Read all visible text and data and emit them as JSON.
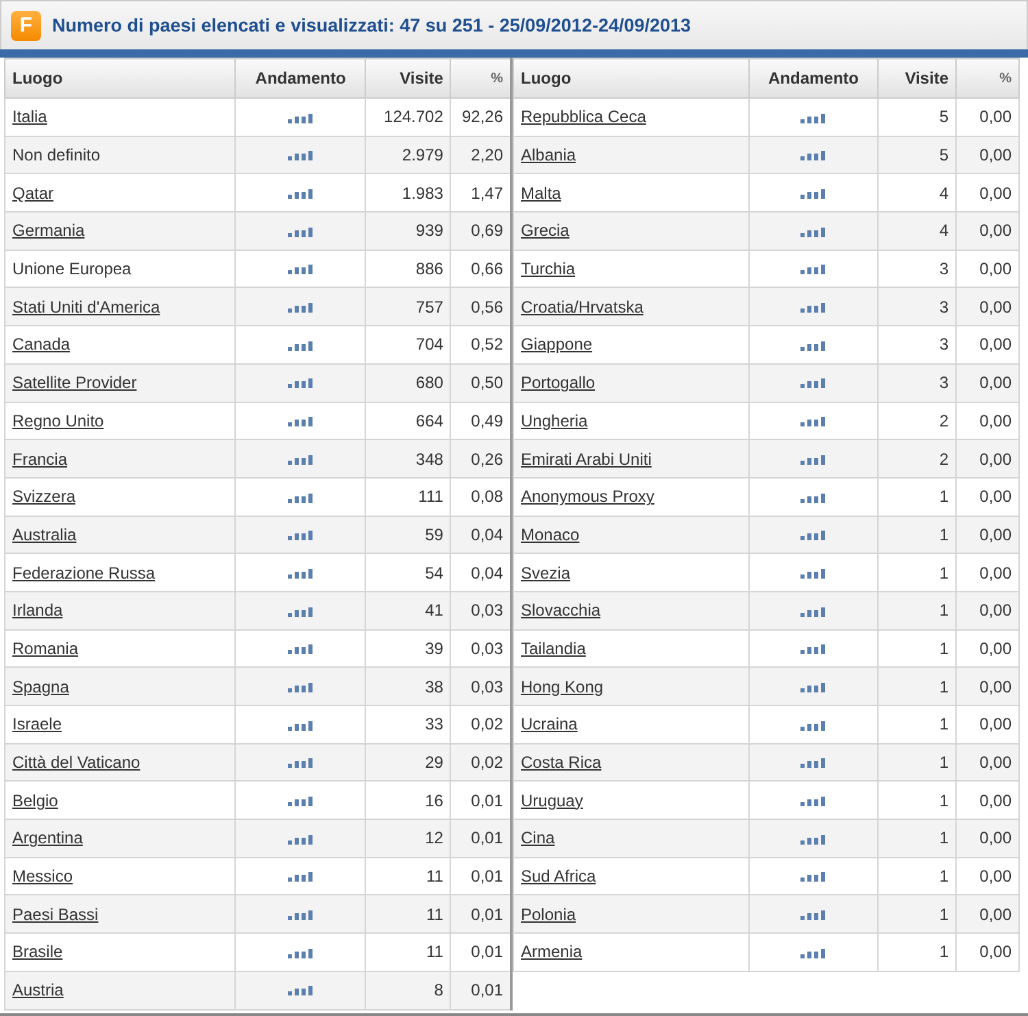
{
  "header": {
    "logo_letter": "F",
    "title": "Numero di paesi elencati e visualizzati: 47 su 251 - 25/09/2012-24/09/2013"
  },
  "tables": [
    {
      "columns": [
        "Luogo",
        "Andamento",
        "Visite",
        "%"
      ],
      "rows": [
        {
          "name": "Italia",
          "link": true,
          "visits": "124.702",
          "percent": "92,26"
        },
        {
          "name": "Non definito",
          "link": false,
          "visits": "2.979",
          "percent": "2,20"
        },
        {
          "name": "Qatar",
          "link": true,
          "visits": "1.983",
          "percent": "1,47"
        },
        {
          "name": "Germania",
          "link": true,
          "visits": "939",
          "percent": "0,69"
        },
        {
          "name": "Unione Europea",
          "link": false,
          "visits": "886",
          "percent": "0,66"
        },
        {
          "name": "Stati Uniti d'America",
          "link": true,
          "visits": "757",
          "percent": "0,56"
        },
        {
          "name": "Canada",
          "link": true,
          "visits": "704",
          "percent": "0,52"
        },
        {
          "name": "Satellite Provider",
          "link": true,
          "visits": "680",
          "percent": "0,50"
        },
        {
          "name": "Regno Unito",
          "link": true,
          "visits": "664",
          "percent": "0,49"
        },
        {
          "name": "Francia",
          "link": true,
          "visits": "348",
          "percent": "0,26"
        },
        {
          "name": "Svizzera",
          "link": true,
          "visits": "111",
          "percent": "0,08"
        },
        {
          "name": "Australia",
          "link": true,
          "visits": "59",
          "percent": "0,04"
        },
        {
          "name": "Federazione Russa",
          "link": true,
          "visits": "54",
          "percent": "0,04"
        },
        {
          "name": "Irlanda",
          "link": true,
          "visits": "41",
          "percent": "0,03"
        },
        {
          "name": "Romania",
          "link": true,
          "visits": "39",
          "percent": "0,03"
        },
        {
          "name": "Spagna",
          "link": true,
          "visits": "38",
          "percent": "0,03"
        },
        {
          "name": "Israele",
          "link": true,
          "visits": "33",
          "percent": "0,02"
        },
        {
          "name": "Città del Vaticano",
          "link": true,
          "visits": "29",
          "percent": "0,02"
        },
        {
          "name": "Belgio",
          "link": true,
          "visits": "16",
          "percent": "0,01"
        },
        {
          "name": "Argentina",
          "link": true,
          "visits": "12",
          "percent": "0,01"
        },
        {
          "name": "Messico",
          "link": true,
          "visits": "11",
          "percent": "0,01"
        },
        {
          "name": "Paesi Bassi",
          "link": true,
          "visits": "11",
          "percent": "0,01"
        },
        {
          "name": "Brasile",
          "link": true,
          "visits": "11",
          "percent": "0,01"
        },
        {
          "name": "Austria",
          "link": true,
          "visits": "8",
          "percent": "0,01"
        }
      ]
    },
    {
      "columns": [
        "Luogo",
        "Andamento",
        "Visite",
        "%"
      ],
      "rows": [
        {
          "name": "Repubblica Ceca",
          "link": true,
          "visits": "5",
          "percent": "0,00"
        },
        {
          "name": "Albania",
          "link": true,
          "visits": "5",
          "percent": "0,00"
        },
        {
          "name": "Malta",
          "link": true,
          "visits": "4",
          "percent": "0,00"
        },
        {
          "name": "Grecia",
          "link": true,
          "visits": "4",
          "percent": "0,00"
        },
        {
          "name": "Turchia",
          "link": true,
          "visits": "3",
          "percent": "0,00"
        },
        {
          "name": "Croatia/Hrvatska",
          "link": true,
          "visits": "3",
          "percent": "0,00"
        },
        {
          "name": "Giappone",
          "link": true,
          "visits": "3",
          "percent": "0,00"
        },
        {
          "name": "Portogallo",
          "link": true,
          "visits": "3",
          "percent": "0,00"
        },
        {
          "name": "Ungheria",
          "link": true,
          "visits": "2",
          "percent": "0,00"
        },
        {
          "name": "Emirati Arabi Uniti",
          "link": true,
          "visits": "2",
          "percent": "0,00"
        },
        {
          "name": "Anonymous Proxy",
          "link": true,
          "visits": "1",
          "percent": "0,00"
        },
        {
          "name": "Monaco",
          "link": true,
          "visits": "1",
          "percent": "0,00"
        },
        {
          "name": "Svezia",
          "link": true,
          "visits": "1",
          "percent": "0,00"
        },
        {
          "name": "Slovacchia",
          "link": true,
          "visits": "1",
          "percent": "0,00"
        },
        {
          "name": "Tailandia",
          "link": true,
          "visits": "1",
          "percent": "0,00"
        },
        {
          "name": "Hong Kong",
          "link": true,
          "visits": "1",
          "percent": "0,00"
        },
        {
          "name": "Ucraina",
          "link": true,
          "visits": "1",
          "percent": "0,00"
        },
        {
          "name": "Costa Rica",
          "link": true,
          "visits": "1",
          "percent": "0,00"
        },
        {
          "name": "Uruguay",
          "link": true,
          "visits": "1",
          "percent": "0,00"
        },
        {
          "name": "Cina",
          "link": true,
          "visits": "1",
          "percent": "0,00"
        },
        {
          "name": "Sud Africa",
          "link": true,
          "visits": "1",
          "percent": "0,00"
        },
        {
          "name": "Polonia",
          "link": true,
          "visits": "1",
          "percent": "0,00"
        },
        {
          "name": "Armenia",
          "link": true,
          "visits": "1",
          "percent": "0,00"
        }
      ]
    }
  ]
}
